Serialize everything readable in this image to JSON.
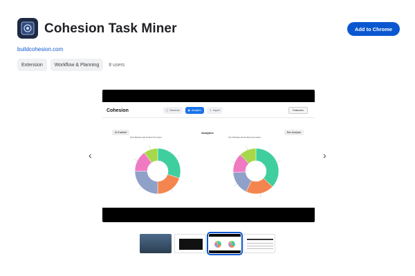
{
  "app": {
    "title": "Cohesion Task Miner",
    "add_button": "Add to Chrome",
    "website": "buildcohesion.com",
    "chips": [
      "Extension",
      "Workflow & Planning"
    ],
    "users": "8 users"
  },
  "carousel": {
    "prev_icon": "chevron-left-icon",
    "next_icon": "chevron-right-icon",
    "selected_thumbnail": 2
  },
  "screenshot": {
    "brand": "Cohesion",
    "tabs": [
      {
        "label": "Sessions",
        "icon": "calendar-icon",
        "active": false
      },
      {
        "label": "Analytics",
        "icon": "chart-icon",
        "active": true
      },
      {
        "label": "Import",
        "icon": "import-icon",
        "active": false
      }
    ],
    "fullscreen": "Fullscreen",
    "ai_button": "AI Enabled",
    "heading": "Analytics",
    "run_button": "Run Analysis",
    "left_donut_title": "Top 5 Websites with the Most Time Spent",
    "right_donut_title": "Top 5 Websites with the Most User Actions"
  },
  "chart_data": [
    {
      "type": "pie",
      "title": "Top 5 Websites with the Most Time Spent",
      "slices": [
        {
          "value": 30,
          "color": "#3fcf9e"
        },
        {
          "value": 20,
          "color": "#f4854f"
        },
        {
          "value": 25,
          "color": "#8fa0c9"
        },
        {
          "value": 15,
          "color": "#ef7ac1"
        },
        {
          "value": 10,
          "color": "#a7d84b"
        }
      ]
    },
    {
      "type": "pie",
      "title": "Top 5 Websites with the Most User Actions",
      "slices": [
        {
          "value": 37,
          "color": "#3fcf9e"
        },
        {
          "value": 20,
          "color": "#f4854f"
        },
        {
          "value": 17,
          "color": "#8fa0c9"
        },
        {
          "value": 14,
          "color": "#ef7ac1"
        },
        {
          "value": 12,
          "color": "#a7d84b"
        }
      ]
    }
  ],
  "colors": {
    "accent": "#0b57d0",
    "active_tab": "#1a73e8"
  }
}
